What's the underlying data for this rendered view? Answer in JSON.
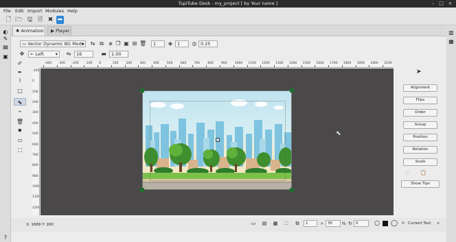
{
  "window": {
    "title": "TupiTube Desk - my_project [ by Your name ]"
  },
  "menu": [
    "File",
    "Edit",
    "Import",
    "Modules",
    "Help"
  ],
  "tabs": [
    {
      "label": "Animation",
      "active": true
    },
    {
      "label": "Player",
      "active": false
    }
  ],
  "options_bar": {
    "bg_mode": "Vector Dynamic BG Mode",
    "frame_value": "1",
    "layer_value": "1",
    "opacity_value": "0.25",
    "align_label": "Left",
    "font_size": "16",
    "scale_value": "1.00"
  },
  "ruler": {
    "top_labels": [
      "-400",
      "-300",
      "-200",
      "-100",
      "0",
      "100",
      "200",
      "300",
      "400",
      "500",
      "600",
      "700",
      "800",
      "900",
      "1000",
      "1100",
      "1200",
      "1300",
      "1400",
      "1500",
      "1600",
      "1700",
      "1800",
      "1900",
      "2000",
      "2100"
    ],
    "left_labels": [
      "-100",
      "0",
      "100",
      "200",
      "300",
      "400",
      "500",
      "600",
      "700",
      "800",
      "900",
      "1000",
      "1100",
      "1200"
    ]
  },
  "right_panel": {
    "buttons": [
      "Alignment",
      "Flips",
      "Order",
      "Group",
      "Position",
      "Rotation",
      "Scale"
    ],
    "show_tips": "Show Tips"
  },
  "status": {
    "coordinates": "X: 1689 Y: 260",
    "frame": "1",
    "zoom": "35",
    "zoom_unit": "%",
    "rotation": "0",
    "current_tool": "Current Tool"
  },
  "colors": {
    "canvas_bg": "#4a4848",
    "panel_bg": "#ececec",
    "titlebar_bg": "#2b2b2b",
    "handle": "#1f6e2f"
  }
}
